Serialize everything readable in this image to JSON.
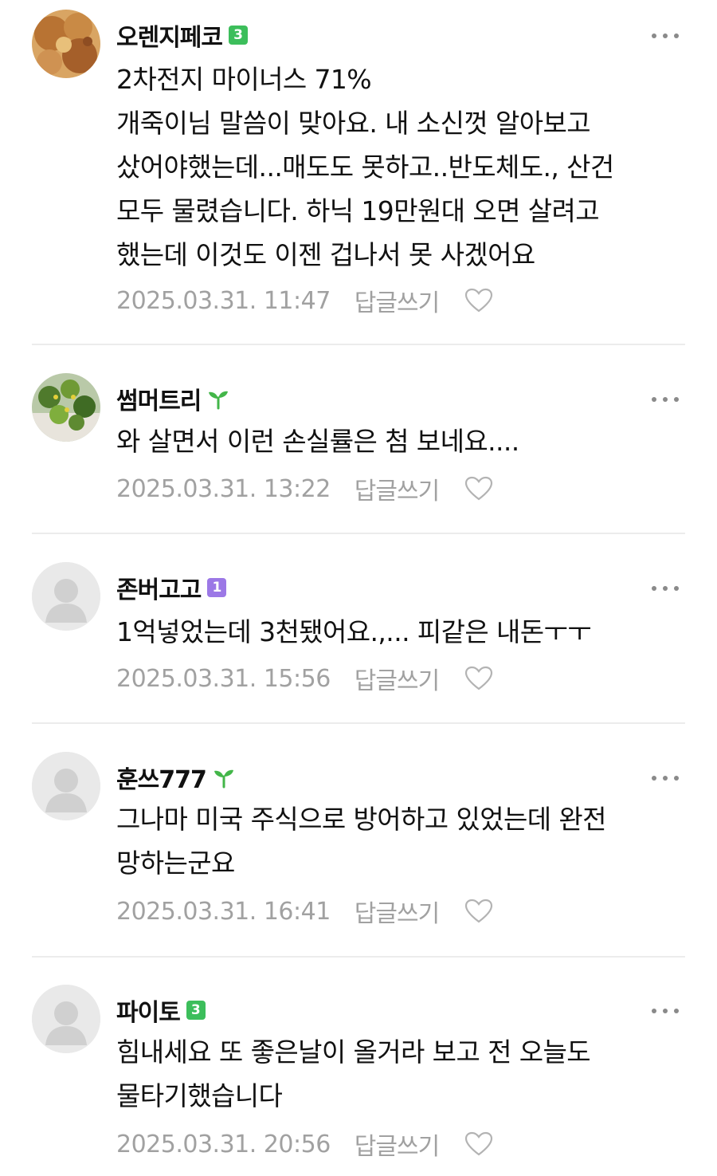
{
  "comments": [
    {
      "nickname": "오렌지페코",
      "badge": "3",
      "badge_color": "#3cbe5b",
      "avatar": "food-photo",
      "text": "2차전지 마이너스 71%\n개죽이님 말씀이 맞아요. 내 소신껏 알아보고\n샀어야했는데...매도도 못하고..반도체도., 산건\n모두 물렸습니다. 하닉 19만원대 오면 살려고\n했는데 이것도 이젠 겁나서 못 사겠어요",
      "date": "2025.03.31. 11:47",
      "reply_label": "답글쓰기"
    },
    {
      "nickname": "썸머트리",
      "badge_icon": "sprout-icon",
      "badge_color": "#43b649",
      "avatar": "plant-photo",
      "text": "와 살면서 이런 손실률은 첨 보네요....",
      "date": "2025.03.31. 13:22",
      "reply_label": "답글쓰기"
    },
    {
      "nickname": "존버고고",
      "badge": "1",
      "badge_color": "#9c78e6",
      "avatar": "default-avatar",
      "text": "1억넣었는데 3천됐어요.,... 피같은 내돈ㅜㅜ",
      "date": "2025.03.31. 15:56",
      "reply_label": "답글쓰기"
    },
    {
      "nickname": "훈쓰777",
      "badge_icon": "sprout-icon",
      "badge_color": "#43b649",
      "avatar": "default-avatar",
      "text": "그나마 미국 주식으로 방어하고 있었는데 완전\n망하는군요",
      "date": "2025.03.31. 16:41",
      "reply_label": "답글쓰기"
    },
    {
      "nickname": "파이토",
      "badge": "3",
      "badge_color": "#3cbe5b",
      "avatar": "default-avatar",
      "text": "힘내세요 또 좋은날이 올거라 보고 전 오늘도\n물타기했습니다",
      "date": "2025.03.31. 20:56",
      "reply_label": "답글쓰기"
    }
  ],
  "colors": {
    "meta_text": "#a1a1a1",
    "divider": "#ececec",
    "heart_outline": "#b3b3b3"
  }
}
